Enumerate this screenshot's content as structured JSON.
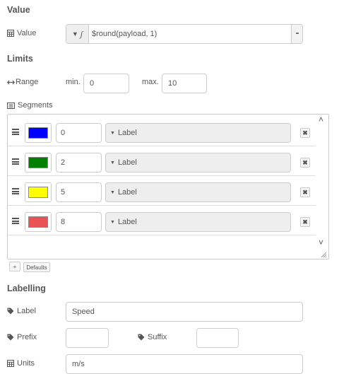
{
  "value_section": {
    "title": "Value",
    "value_label": "Value",
    "type_glyph": "ʃ",
    "expression": "$round(payload, 1)",
    "expand_glyph": "•••"
  },
  "limits_section": {
    "title": "Limits",
    "range_label": "Range",
    "min_label": "min.",
    "min_value": "0",
    "max_label": "max.",
    "max_value": "10",
    "segments_label": "Segments"
  },
  "segments": [
    {
      "color": "#0000ff",
      "from": "0",
      "label_placeholder": "Label"
    },
    {
      "color": "#008000",
      "from": "2",
      "label_placeholder": "Label"
    },
    {
      "color": "#ffff00",
      "from": "5",
      "label_placeholder": "Label"
    },
    {
      "color": "#ea5353",
      "from": "8",
      "label_placeholder": "Label"
    }
  ],
  "segment_controls": {
    "add_glyph": "+",
    "defaults_label": "Defaults",
    "remove_glyph": "✖",
    "scroll_up": "˄",
    "scroll_down": "˅"
  },
  "labelling_section": {
    "title": "Labelling",
    "label_label": "Label",
    "label_value": "Speed",
    "prefix_label": "Prefix",
    "prefix_value": "",
    "suffix_label": "Suffix",
    "suffix_value": "",
    "units_label": "Units",
    "units_value": "m/s"
  },
  "icons": {
    "value": "table-icon",
    "range": "arrows-h-icon",
    "segments": "list-alt-icon",
    "label": "tag-icon",
    "prefix": "tag-icon",
    "suffix": "tag-icon",
    "units": "table-icon"
  }
}
